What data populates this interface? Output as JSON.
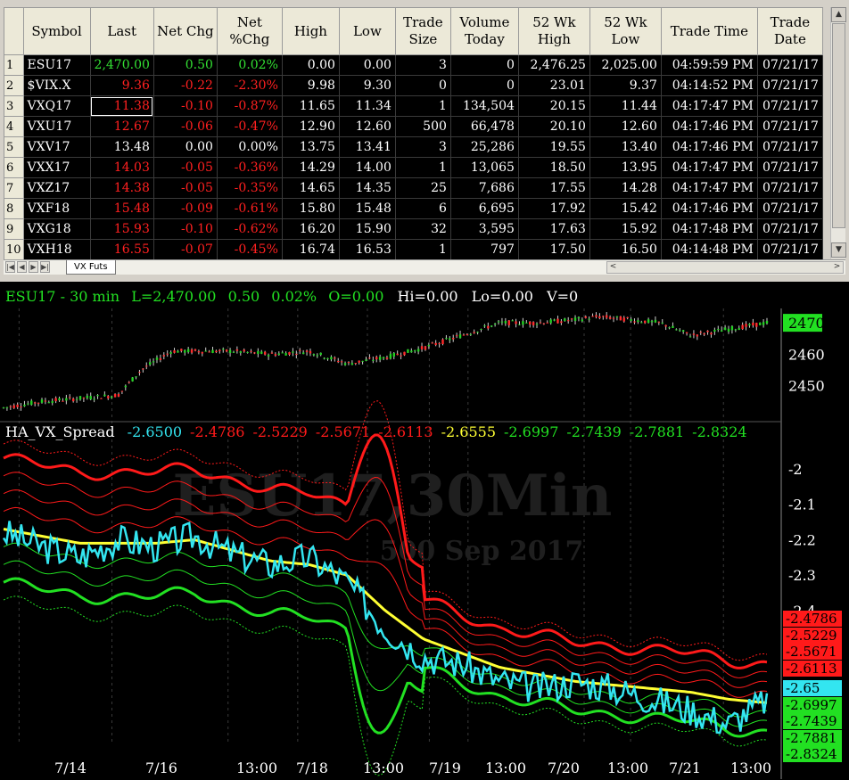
{
  "table": {
    "headers": [
      "Symbol",
      "Last",
      "Net Chg",
      "Net %Chg",
      "High",
      "Low",
      "Trade Size",
      "Volume Today",
      "52 Wk High",
      "52 Wk Low",
      "Trade Time",
      "Trade Date"
    ],
    "rows": [
      {
        "n": "1",
        "sym": "ESU17",
        "last": "2,470.00",
        "chg": "0.50",
        "pct": "0.02%",
        "high": "0.00",
        "low": "0.00",
        "size": "3",
        "vol": "0",
        "wkh": "2,476.25",
        "wkl": "2,025.00",
        "time": "04:59:59 PM",
        "date": "07/21/17",
        "dir": "pos"
      },
      {
        "n": "2",
        "sym": "$VIX.X",
        "last": "9.36",
        "chg": "-0.22",
        "pct": "-2.30%",
        "high": "9.98",
        "low": "9.30",
        "size": "0",
        "vol": "0",
        "wkh": "23.01",
        "wkl": "9.37",
        "time": "04:14:52 PM",
        "date": "07/21/17",
        "dir": "neg"
      },
      {
        "n": "3",
        "sym": "VXQ17",
        "last": "11.38",
        "chg": "-0.10",
        "pct": "-0.87%",
        "high": "11.65",
        "low": "11.34",
        "size": "1",
        "vol": "134,504",
        "wkh": "20.15",
        "wkl": "11.44",
        "time": "04:17:47 PM",
        "date": "07/21/17",
        "dir": "neg"
      },
      {
        "n": "4",
        "sym": "VXU17",
        "last": "12.67",
        "chg": "-0.06",
        "pct": "-0.47%",
        "high": "12.90",
        "low": "12.60",
        "size": "500",
        "vol": "66,478",
        "wkh": "20.10",
        "wkl": "12.60",
        "time": "04:17:46 PM",
        "date": "07/21/17",
        "dir": "neg"
      },
      {
        "n": "5",
        "sym": "VXV17",
        "last": "13.48",
        "chg": "0.00",
        "pct": "0.00%",
        "high": "13.75",
        "low": "13.41",
        "size": "3",
        "vol": "25,286",
        "wkh": "19.55",
        "wkl": "13.40",
        "time": "04:17:46 PM",
        "date": "07/21/17",
        "dir": "flat"
      },
      {
        "n": "6",
        "sym": "VXX17",
        "last": "14.03",
        "chg": "-0.05",
        "pct": "-0.36%",
        "high": "14.29",
        "low": "14.00",
        "size": "1",
        "vol": "13,065",
        "wkh": "18.50",
        "wkl": "13.95",
        "time": "04:17:47 PM",
        "date": "07/21/17",
        "dir": "neg"
      },
      {
        "n": "7",
        "sym": "VXZ17",
        "last": "14.38",
        "chg": "-0.05",
        "pct": "-0.35%",
        "high": "14.65",
        "low": "14.35",
        "size": "25",
        "vol": "7,686",
        "wkh": "17.55",
        "wkl": "14.28",
        "time": "04:17:47 PM",
        "date": "07/21/17",
        "dir": "neg"
      },
      {
        "n": "8",
        "sym": "VXF18",
        "last": "15.48",
        "chg": "-0.09",
        "pct": "-0.61%",
        "high": "15.80",
        "low": "15.48",
        "size": "6",
        "vol": "6,695",
        "wkh": "17.92",
        "wkl": "15.42",
        "time": "04:17:46 PM",
        "date": "07/21/17",
        "dir": "neg"
      },
      {
        "n": "9",
        "sym": "VXG18",
        "last": "15.93",
        "chg": "-0.10",
        "pct": "-0.62%",
        "high": "16.20",
        "low": "15.90",
        "size": "32",
        "vol": "3,595",
        "wkh": "17.63",
        "wkl": "15.92",
        "time": "04:17:48 PM",
        "date": "07/21/17",
        "dir": "neg"
      },
      {
        "n": "10",
        "sym": "VXH18",
        "last": "16.55",
        "chg": "-0.07",
        "pct": "-0.45%",
        "high": "16.74",
        "low": "16.53",
        "size": "1",
        "vol": "797",
        "wkh": "17.50",
        "wkl": "16.50",
        "time": "04:14:48 PM",
        "date": "07/21/17",
        "dir": "neg"
      }
    ]
  },
  "sheet_tab": "VX Futs",
  "colors": {
    "pos": "#33e033",
    "neg": "#ff2020",
    "flat": "#ffffff",
    "cyan": "#33e5f0",
    "yellow": "#ffff33",
    "red": "#ff1a1a",
    "green": "#22e022"
  },
  "chart": {
    "header": {
      "symbol": "ESU17 - 30 min",
      "last": "L=2,470.00",
      "chg": "0.50",
      "pct": "0.02%",
      "open": "O=0.00",
      "hi": "Hi=0.00",
      "lo": "Lo=0.00",
      "vol": "V=0"
    },
    "watermark": {
      "line1": "ESU17,30Min",
      "line2": "500 Sep 2017"
    },
    "price_badge": "2470",
    "price_ticks": [
      "2460",
      "2450"
    ],
    "indicator": {
      "name": "HA_VX_Spread",
      "values": [
        {
          "v": "-2.6500",
          "c": "cyan"
        },
        {
          "v": "-2.4786",
          "c": "red"
        },
        {
          "v": "-2.5229",
          "c": "red"
        },
        {
          "v": "-2.5671",
          "c": "red"
        },
        {
          "v": "-2.6113",
          "c": "red"
        },
        {
          "v": "-2.6555",
          "c": "yellow"
        },
        {
          "v": "-2.6997",
          "c": "green"
        },
        {
          "v": "-2.7439",
          "c": "green"
        },
        {
          "v": "-2.7881",
          "c": "green"
        },
        {
          "v": "-2.8324",
          "c": "green"
        }
      ]
    },
    "right_badges": [
      {
        "v": "-2.4786",
        "c": "red"
      },
      {
        "v": "-2.5229",
        "c": "red"
      },
      {
        "v": "-2.5671",
        "c": "red"
      },
      {
        "v": "-2.6113",
        "c": "red"
      },
      {
        "v": "-2.65",
        "c": "cyan"
      },
      {
        "v": "-2.6997",
        "c": "green"
      },
      {
        "v": "-2.7439",
        "c": "green"
      },
      {
        "v": "-2.7881",
        "c": "green"
      },
      {
        "v": "-2.8324",
        "c": "green"
      }
    ]
  },
  "chart_data": {
    "type": "line",
    "price_axis": {
      "ticks": [
        2460,
        2450
      ],
      "current": 2470
    },
    "indicator_axis": {
      "ylim": [
        -2.85,
        -1.95
      ],
      "ticks": [
        -2,
        -2.1,
        -2.2,
        -2.3,
        -2.4
      ]
    },
    "x_labels": [
      "7/14",
      "7/16",
      "13:00",
      "7/18",
      "13:00",
      "7/19",
      "13:00",
      "7/20",
      "13:00",
      "7/21",
      "13:00"
    ],
    "price_series": {
      "x": [
        0,
        0.05,
        0.1,
        0.15,
        0.18,
        0.22,
        0.3,
        0.35,
        0.4,
        0.45,
        0.5,
        0.55,
        0.6,
        0.65,
        0.7,
        0.75,
        0.78,
        0.82,
        0.86,
        0.9,
        0.95,
        1
      ],
      "values": [
        2443,
        2445,
        2446,
        2447,
        2455,
        2461,
        2461,
        2460,
        2461,
        2457,
        2459,
        2462,
        2466,
        2470,
        2470,
        2471,
        2472,
        2471,
        2470,
        2466,
        2468,
        2470
      ]
    },
    "indicator_series": {
      "x": [
        0,
        0.05,
        0.1,
        0.15,
        0.2,
        0.25,
        0.3,
        0.35,
        0.4,
        0.45,
        0.5,
        0.55,
        0.6,
        0.65,
        0.7,
        0.75,
        0.8,
        0.85,
        0.9,
        0.95,
        1
      ],
      "values": [
        -2.18,
        -2.22,
        -2.25,
        -2.2,
        -2.22,
        -2.19,
        -2.24,
        -2.27,
        -2.25,
        -2.32,
        -2.45,
        -2.53,
        -2.55,
        -2.6,
        -2.62,
        -2.6,
        -2.62,
        -2.65,
        -2.68,
        -2.72,
        -2.65
      ]
    },
    "mid_band": {
      "x": [
        0,
        0.05,
        0.1,
        0.15,
        0.2,
        0.25,
        0.3,
        0.35,
        0.4,
        0.45,
        0.5,
        0.55,
        0.6,
        0.65,
        0.7,
        0.75,
        0.8,
        0.85,
        0.9,
        0.95,
        1
      ],
      "values": [
        -2.17,
        -2.19,
        -2.21,
        -2.21,
        -2.21,
        -2.2,
        -2.23,
        -2.26,
        -2.27,
        -2.3,
        -2.4,
        -2.48,
        -2.52,
        -2.56,
        -2.58,
        -2.6,
        -2.61,
        -2.62,
        -2.63,
        -2.65,
        -2.66
      ]
    }
  }
}
